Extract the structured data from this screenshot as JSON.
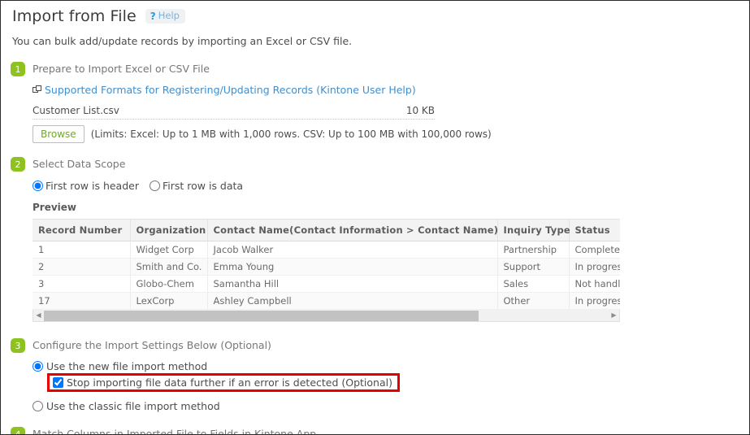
{
  "header": {
    "title": "Import from File",
    "help_icon": "question-mark-icon",
    "help_label": "Help"
  },
  "intro": "You can bulk add/update records by importing an Excel or CSV file.",
  "steps": {
    "step1": {
      "number": "1",
      "label": "Prepare to Import Excel or CSV File",
      "link_icon": "external-window-icon",
      "link_text": "Supported Formats for Registering/Updating Records (Kintone User Help)",
      "file_name": "Customer List.csv",
      "file_size": "10 KB",
      "browse_label": "Browse",
      "limits_text": "(Limits: Excel: Up to 1 MB with 1,000 rows. CSV: Up to 100 MB with 100,000 rows)"
    },
    "step2": {
      "number": "2",
      "label": "Select Data Scope",
      "radio_header": "First row is header",
      "radio_data": "First row is data",
      "preview_label": "Preview"
    },
    "step3": {
      "number": "3",
      "label": "Configure the Import Settings Below (Optional)",
      "radio_new": "Use the new file import method",
      "checkbox_stop": "Stop importing file data further if an error is detected (Optional)",
      "radio_classic": "Use the classic file import method"
    },
    "step4": {
      "number": "4",
      "label": "Match Columns in Imported File to Fields in Kintone App"
    }
  },
  "preview_table": {
    "columns": [
      "Record Number",
      "Organization",
      "Contact Name(Contact Information > Contact Name)",
      "Inquiry Type",
      "Status"
    ],
    "rows": [
      [
        "1",
        "Widget Corp",
        "Jacob Walker",
        "Partnership",
        "Complete"
      ],
      [
        "2",
        "Smith and Co.",
        "Emma Young",
        "Support",
        "In progress"
      ],
      [
        "3",
        "Globo-Chem",
        "Samantha Hill",
        "Sales",
        "Not handled"
      ],
      [
        "17",
        "LexCorp",
        "Ashley Campbell",
        "Other",
        "In progress"
      ]
    ],
    "scrollbar": {
      "left_arrow": "triangle-left-icon",
      "right_arrow": "triangle-right-icon",
      "thumb_fraction": "77%"
    }
  },
  "colors": {
    "step_badge_green": "#8dc21f",
    "link_blue": "#3f8fd0",
    "browse_green": "#77a531",
    "highlight_red": "#e60000",
    "control_blue": "#1a73e8"
  }
}
